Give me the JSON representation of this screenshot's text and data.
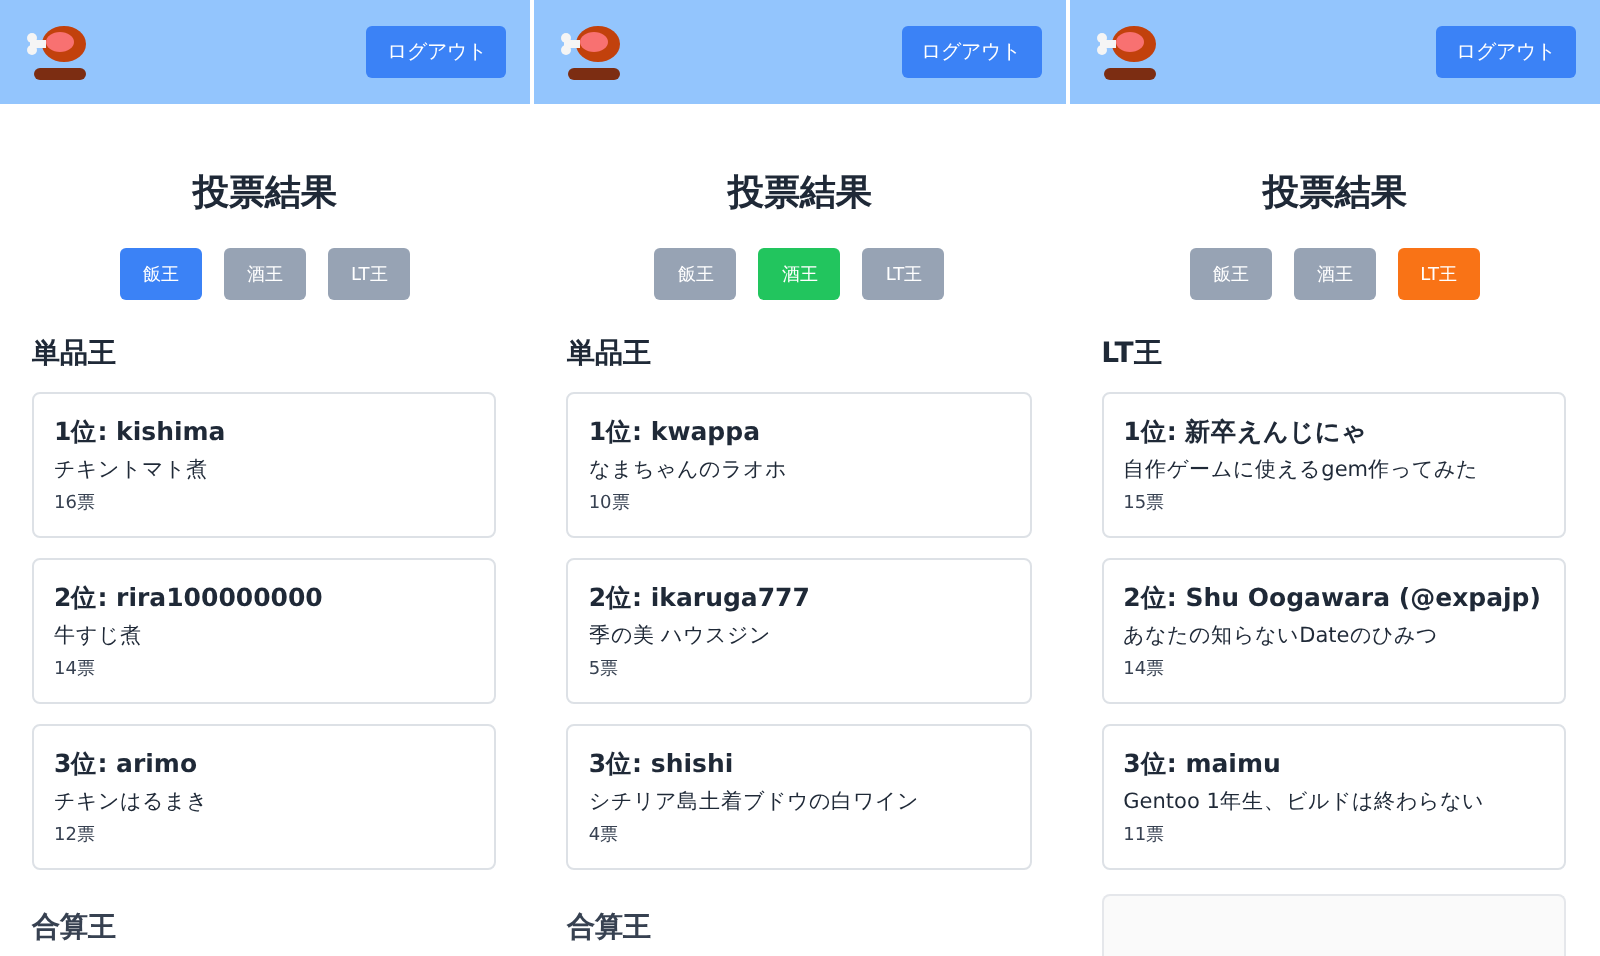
{
  "panels": [
    {
      "logout": "ログアウト",
      "title": "投票結果",
      "tabs": [
        {
          "label": "飯王",
          "selected": true,
          "color": "#3b82f6"
        },
        {
          "label": "酒王",
          "selected": false
        },
        {
          "label": "LT王",
          "selected": false
        }
      ],
      "section": "単品王",
      "entries": [
        {
          "heading": "1位: kishima",
          "detail": "チキントマト煮",
          "votes": "16票"
        },
        {
          "heading": "2位: rira100000000",
          "detail": "牛すじ煮",
          "votes": "14票"
        },
        {
          "heading": "3位: arimo",
          "detail": "チキンはるまき",
          "votes": "12票"
        }
      ],
      "next": {
        "kind": "heading",
        "text": "合算王"
      }
    },
    {
      "logout": "ログアウト",
      "title": "投票結果",
      "tabs": [
        {
          "label": "飯王",
          "selected": false
        },
        {
          "label": "酒王",
          "selected": true,
          "color": "#22c55e"
        },
        {
          "label": "LT王",
          "selected": false
        }
      ],
      "section": "単品王",
      "entries": [
        {
          "heading": "1位: kwappa",
          "detail": "なまちゃんのラオホ",
          "votes": "10票"
        },
        {
          "heading": "2位: ikaruga777",
          "detail": "季の美 ハウスジン",
          "votes": "5票"
        },
        {
          "heading": "3位: shishi",
          "detail": "シチリア島土着ブドウの白ワイン",
          "votes": "4票"
        }
      ],
      "next": {
        "kind": "heading",
        "text": "合算王"
      }
    },
    {
      "logout": "ログアウト",
      "title": "投票結果",
      "tabs": [
        {
          "label": "飯王",
          "selected": false
        },
        {
          "label": "酒王",
          "selected": false
        },
        {
          "label": "LT王",
          "selected": true,
          "color": "#f97316"
        }
      ],
      "section": "LT王",
      "entries": [
        {
          "heading": "1位: 新卒えんじにゃ",
          "detail": "自作ゲームに使えるgem作ってみた",
          "votes": "15票"
        },
        {
          "heading": "2位: Shu Oogawara (@expajp)",
          "detail": "あなたの知らないDateのひみつ",
          "votes": "14票"
        },
        {
          "heading": "3位: maimu",
          "detail": "Gentoo 1年生、ビルドは終わらない",
          "votes": "11票"
        }
      ],
      "next": {
        "kind": "card"
      }
    }
  ]
}
